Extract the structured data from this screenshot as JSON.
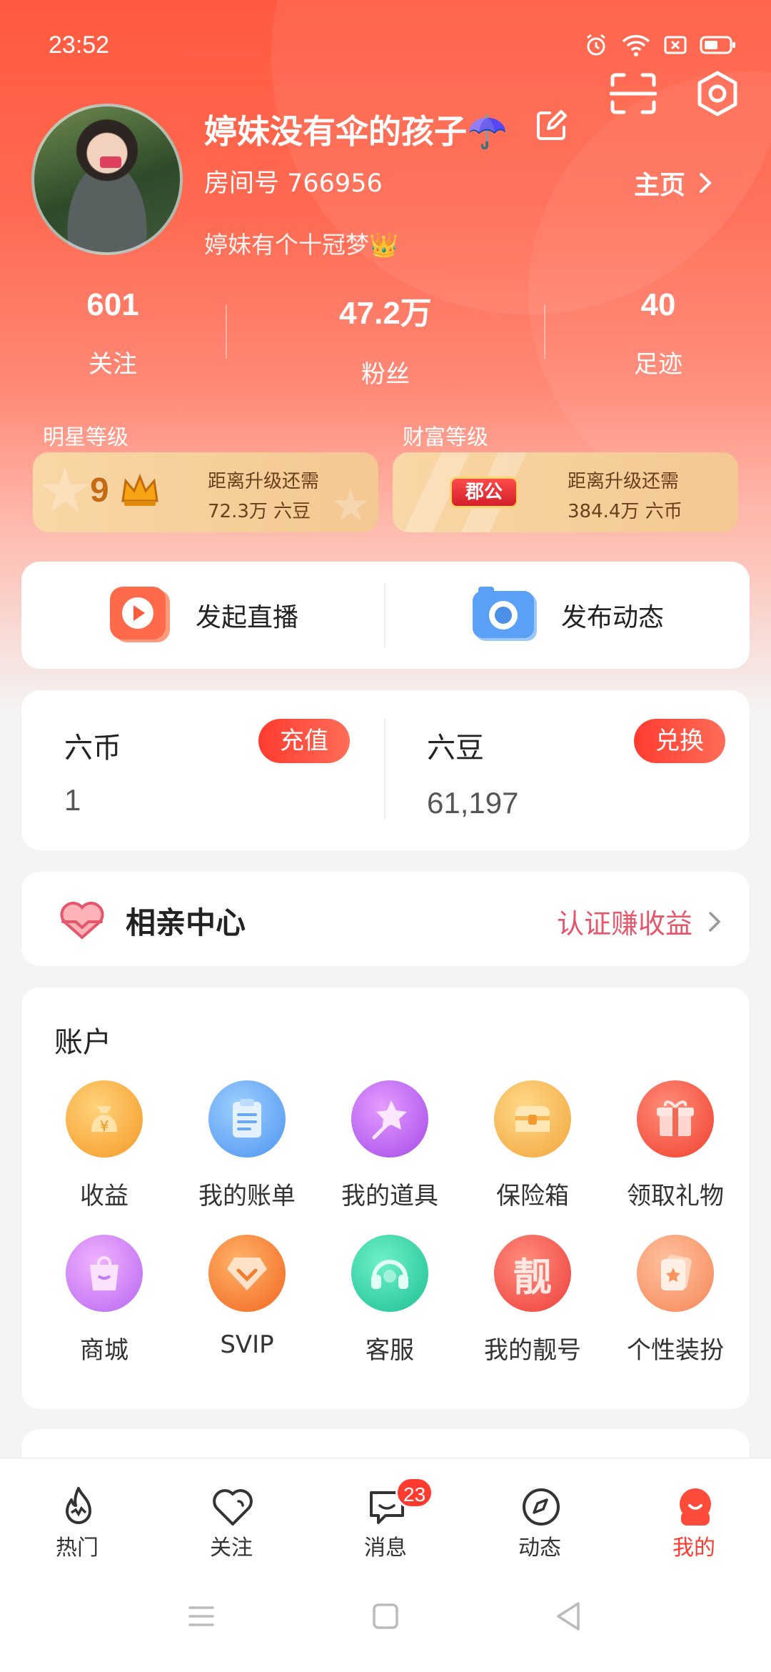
{
  "status_bar": {
    "time": "23:52",
    "icons": [
      "alarm-icon",
      "wifi-icon",
      "sim-icon",
      "battery-icon"
    ]
  },
  "header": {
    "scan_icon": "scan-icon",
    "settings_icon": "settings-icon"
  },
  "profile": {
    "nickname": "婷妹没有伞的孩子☂️",
    "room_label": "房间号 766956",
    "homepage_label": "主页",
    "signature": "婷妹有个十冠梦👑"
  },
  "stats": [
    {
      "value": "601",
      "label": "关注"
    },
    {
      "value": "47.2万",
      "label": "粉丝"
    },
    {
      "value": "40",
      "label": "足迹"
    }
  ],
  "levels": {
    "star": {
      "label": "明星等级",
      "badge": "9",
      "line1": "距离升级还需",
      "line2": "72.3万 六豆"
    },
    "wealth": {
      "label": "财富等级",
      "badge": "郡公",
      "line1": "距离升级还需",
      "line2": "384.4万 六币"
    }
  },
  "actions": {
    "start_live": "发起直播",
    "post_moment": "发布动态"
  },
  "wallet": {
    "coins": {
      "name": "六币",
      "value": "1",
      "button": "充值"
    },
    "beans": {
      "name": "六豆",
      "value": "61,197",
      "button": "兑换"
    }
  },
  "dating": {
    "title": "相亲中心",
    "action": "认证赚收益"
  },
  "account": {
    "title": "账户",
    "items": [
      {
        "label": "收益",
        "icon": "earnings-icon"
      },
      {
        "label": "我的账单",
        "icon": "bill-icon"
      },
      {
        "label": "我的道具",
        "icon": "props-icon"
      },
      {
        "label": "保险箱",
        "icon": "safe-box-icon"
      },
      {
        "label": "领取礼物",
        "icon": "gift-icon"
      },
      {
        "label": "商城",
        "icon": "shop-icon"
      },
      {
        "label": "SVIP",
        "icon": "svip-icon"
      },
      {
        "label": "客服",
        "icon": "customer-service-icon"
      },
      {
        "label": "我的靓号",
        "icon": "vanity-number-icon"
      },
      {
        "label": "个性装扮",
        "icon": "dress-up-icon"
      }
    ]
  },
  "tabbar": {
    "items": [
      {
        "label": "热门",
        "icon": "hot-icon"
      },
      {
        "label": "关注",
        "icon": "follow-heart-icon"
      },
      {
        "label": "消息",
        "icon": "message-icon",
        "badge": "23"
      },
      {
        "label": "动态",
        "icon": "compass-icon"
      },
      {
        "label": "我的",
        "icon": "me-icon"
      }
    ],
    "active_index": 4
  },
  "colors": {
    "accent": "#ff3b30",
    "hero_top": "#ff5a3f",
    "level_card": "#f6cf9a",
    "dating_accent": "#e5566a"
  }
}
